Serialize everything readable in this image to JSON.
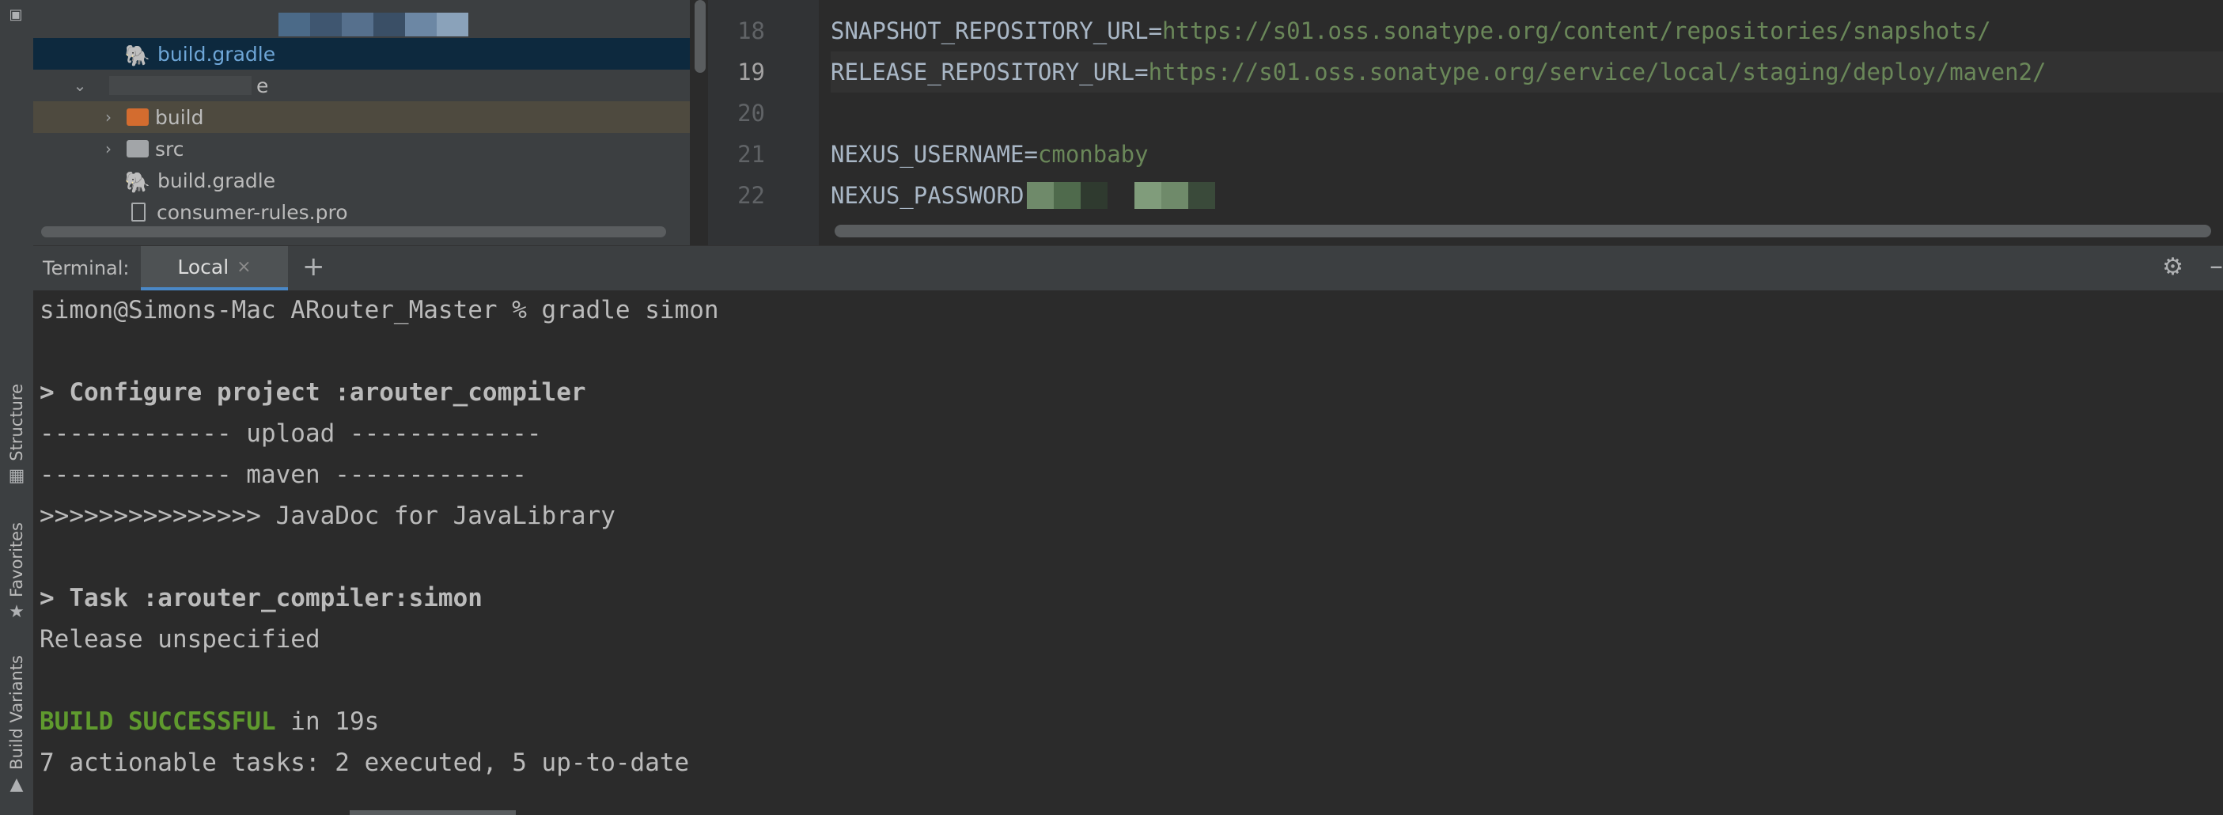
{
  "left_strip": {
    "tabs": [
      {
        "label": "Structure",
        "icon": "structure-icon"
      },
      {
        "label": "Favorites",
        "icon": "star-icon"
      },
      {
        "label": "Build Variants",
        "icon": "android-icon"
      }
    ]
  },
  "project_tree": {
    "items": [
      {
        "label": "build.gradle",
        "icon": "gradle-icon",
        "selected": true
      },
      {
        "label": "e",
        "icon": "",
        "expanded": true
      },
      {
        "label": "build",
        "icon": "folder-icon",
        "color": "#d36c2f"
      },
      {
        "label": "src",
        "icon": "folder-icon",
        "color": "#a2a5a8"
      },
      {
        "label": "build.gradle",
        "icon": "gradle-icon"
      },
      {
        "label": "consumer-rules.pro",
        "icon": "file-icon"
      }
    ]
  },
  "editor": {
    "lines": [
      {
        "number": "18",
        "key": "SNAPSHOT_REPOSITORY_URL",
        "sep": "=",
        "value": "https://s01.oss.sonatype.org/content/repositories/snapshots/"
      },
      {
        "number": "19",
        "key": "RELEASE_REPOSITORY_URL",
        "sep": "=",
        "value": "https://s01.oss.sonatype.org/service/local/staging/deploy/maven2/",
        "current": true
      },
      {
        "number": "20",
        "key": "",
        "sep": "",
        "value": ""
      },
      {
        "number": "21",
        "key": "NEXUS_USERNAME",
        "sep": "=",
        "value": "cmonbaby"
      },
      {
        "number": "22",
        "key": "NEXUS_PASSWORD",
        "sep": "",
        "value": ""
      }
    ]
  },
  "terminal": {
    "title": "Terminal:",
    "tab_label": "Local",
    "lines": [
      "simon@Simons-Mac ARouter_Master % gradle simon",
      "",
      "> Configure project :arouter_compiler",
      "------------- upload -------------",
      "------------- maven -------------",
      ">>>>>>>>>>>>>>> JavaDoc for JavaLibrary",
      "",
      "> Task :arouter_compiler:simon",
      "Release unspecified",
      "",
      "",
      "7 actionable tasks: 2 executed, 5 up-to-date"
    ],
    "success_word": "BUILD SUCCESSFUL",
    "success_rest": " in 19s"
  },
  "colors": {
    "accent": "#4a88c7",
    "success": "#5f9a2e",
    "string": "#6a8759"
  }
}
